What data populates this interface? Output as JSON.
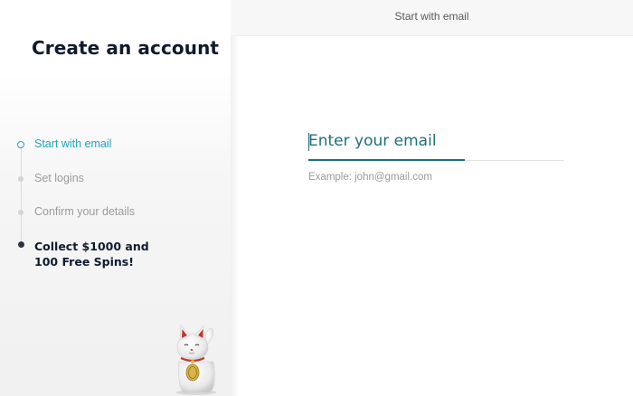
{
  "sidebar": {
    "title": "Create an account",
    "steps": [
      {
        "label": "Start with email",
        "state": "active"
      },
      {
        "label": "Set logins",
        "state": "pending"
      },
      {
        "label": "Confirm your details",
        "state": "pending"
      },
      {
        "label": "Collect $1000 and 100 Free Spins!",
        "state": "final"
      }
    ],
    "mascot": "lucky-cat-icon"
  },
  "header": {
    "title": "Start with email"
  },
  "form": {
    "email_placeholder": "Enter your email",
    "email_value": "",
    "hint": "Example: john@gmail.com"
  },
  "colors": {
    "accent": "#22a3bf",
    "field_accent": "#1f6f7a",
    "title": "#0f1b2d",
    "muted": "#9b9b9b"
  }
}
